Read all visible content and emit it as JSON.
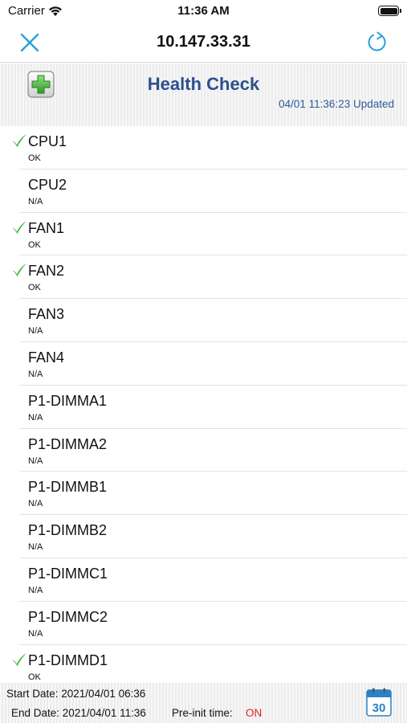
{
  "status_bar": {
    "carrier": "Carrier",
    "time": "11:36 AM",
    "icons": [
      "wifi-icon",
      "battery-icon"
    ]
  },
  "nav": {
    "title": "10.147.33.31",
    "close_icon": "close-icon",
    "refresh_icon": "refresh-icon",
    "accent_color": "#2a9fd8"
  },
  "header": {
    "title": "Health Check",
    "updated": "04/01 11:36:23 Updated",
    "icon": "medical-cross-icon",
    "title_color": "#2d4f8f"
  },
  "sensors": [
    {
      "name": "CPU1",
      "status": "OK",
      "checked": true
    },
    {
      "name": "CPU2",
      "status": "N/A",
      "checked": false
    },
    {
      "name": "FAN1",
      "status": "OK",
      "checked": true
    },
    {
      "name": "FAN2",
      "status": "OK",
      "checked": true
    },
    {
      "name": "FAN3",
      "status": "N/A",
      "checked": false
    },
    {
      "name": "FAN4",
      "status": "N/A",
      "checked": false
    },
    {
      "name": "P1-DIMMA1",
      "status": "N/A",
      "checked": false
    },
    {
      "name": "P1-DIMMA2",
      "status": "N/A",
      "checked": false
    },
    {
      "name": "P1-DIMMB1",
      "status": "N/A",
      "checked": false
    },
    {
      "name": "P1-DIMMB2",
      "status": "N/A",
      "checked": false
    },
    {
      "name": "P1-DIMMC1",
      "status": "N/A",
      "checked": false
    },
    {
      "name": "P1-DIMMC2",
      "status": "N/A",
      "checked": false
    },
    {
      "name": "P1-DIMMD1",
      "status": "OK",
      "checked": true
    }
  ],
  "footer": {
    "start_date": "Start Date: 2021/04/01 06:36",
    "end_date": "End Date: 2021/04/01 11:36",
    "preinit_label": "Pre-init time:",
    "preinit_value": "ON",
    "preinit_color": "#e02020",
    "calendar_day": "30",
    "calendar_icon": "calendar-icon"
  },
  "check_color": "#2db52d"
}
